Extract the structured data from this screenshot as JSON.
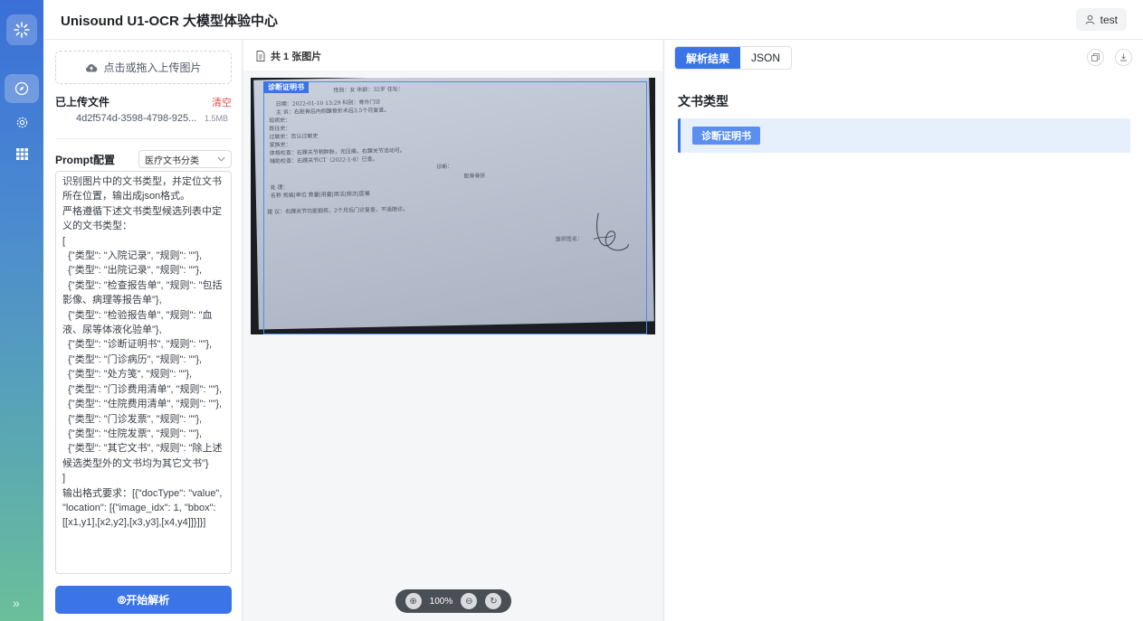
{
  "app": {
    "title": "Unisound U1-OCR 大模型体验中心"
  },
  "header": {
    "user_name": "test"
  },
  "rail": {
    "items": [
      "logo-icon",
      "compass-icon",
      "gear-icon",
      "grid-icon"
    ],
    "expand_icon": "double-chevron-right-icon"
  },
  "config": {
    "upload_label": "点击或拖入上传图片",
    "uploaded_title": "已上传文件",
    "clear_label": "清空",
    "file": {
      "name": "4d2f574d-3598-4798-925...",
      "size": "1.5MB"
    },
    "prompt_label": "Prompt配置",
    "prompt_select": "医疗文书分类",
    "prompt_text": "识别图片中的文书类型，并定位文书所在位置，输出成json格式。\n严格遵循下述文书类型候选列表中定义的文书类型：\n[\n  {\"类型\": \"入院记录\", \"规则\": \"\"},\n  {\"类型\": \"出院记录\", \"规则\": \"\"},\n  {\"类型\": \"检查报告单\", \"规则\": \"包括影像、病理等报告单\"},\n  {\"类型\": \"检验报告单\", \"规则\": \"血液、尿等体液化验单\"},\n  {\"类型\": \"诊断证明书\", \"规则\": \"\"},\n  {\"类型\": \"门诊病历\", \"规则\": \"\"},\n  {\"类型\": \"处方笺\", \"规则\": \"\"},\n  {\"类型\": \"门诊费用清单\", \"规则\": \"\"},\n  {\"类型\": \"住院费用清单\", \"规则\": \"\"},\n  {\"类型\": \"门诊发票\", \"规则\": \"\"},\n  {\"类型\": \"住院发票\", \"规则\": \"\"},\n  {\"类型\": \"其它文书\", \"规则\": \"除上述候选类型外的文书均为其它文书\"}\n]\n输出格式要求：[{\"docType\": \"value\", \"location\": [{\"image_idx\": 1, \"bbox\": [[x1,y1],[x2,y2],[x3,y3],[x4,y4]]}]}]",
    "start_label": "⦾开始解析"
  },
  "viewer": {
    "count_label": "共 1 张图片",
    "doc_tag": "诊断证明书",
    "doc_lines": [
      "性别：女        年龄：32岁          住址：",
      "日期：2022-01-10  13:29                                    科别：骨外门诊",
      "主  诉：右距骨后内侧踝骨折术后3.5个月复查。",
      "现病史：",
      "既往史：",
      "过敏史：否认过敏史",
      "家族史：",
      "体格检查：右踝关节稍肿胀，无压痛，右踝关节活动可。",
      "辅助检查：右踝关节CT（2022-1-8）已查。",
      "诊断：",
      "距骨骨折",
      "处  理：",
      "名称              规格|单位           数量|用量|用法|频次|医嘱",
      "建  议：右踝关节功能锻炼，2个月后门诊复查，不适随诊。",
      "医师签名："
    ],
    "zoom": "100%"
  },
  "results": {
    "tabs": [
      {
        "label": "解析结果",
        "active": true
      },
      {
        "label": "JSON",
        "active": false
      }
    ],
    "section_title": "文书类型",
    "doc_type": "诊断证明书"
  }
}
